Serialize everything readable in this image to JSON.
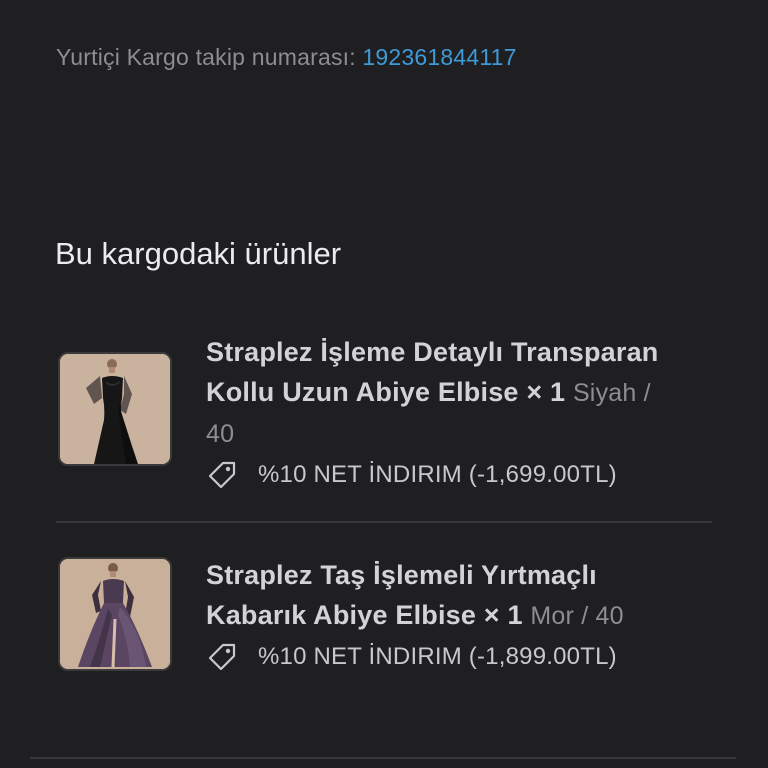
{
  "tracking": {
    "label": "Yurtiçi Kargo takip numarası:",
    "number": "192361844117"
  },
  "section": {
    "title": "Bu kargodaki ürünler"
  },
  "items": [
    {
      "title_line1": "Straplez İşleme Detaylı Transparan",
      "title_line2": "Kollu Uzun Abiye Elbise × 1",
      "variant_a": "Siyah /",
      "variant_b": "40",
      "discount": "%10 NET İNDIRIM (-1,699.00TL)",
      "image_icon": "dress-black-image",
      "discount_icon": "tag-icon"
    },
    {
      "title_line1": "Straplez Taş İşlemeli Yırtmaçlı",
      "title_line2": "Kabarık Abiye Elbise × 1",
      "variant": "Mor / 40",
      "discount": "%10 NET İNDIRIM (-1,899.00TL)",
      "image_icon": "dress-purple-image",
      "discount_icon": "tag-icon"
    }
  ],
  "colors": {
    "background": "#1f1f21",
    "link": "#3f9ad8",
    "muted": "#8d8d92",
    "text": "#d3d3d6",
    "divider": "#38383b"
  }
}
